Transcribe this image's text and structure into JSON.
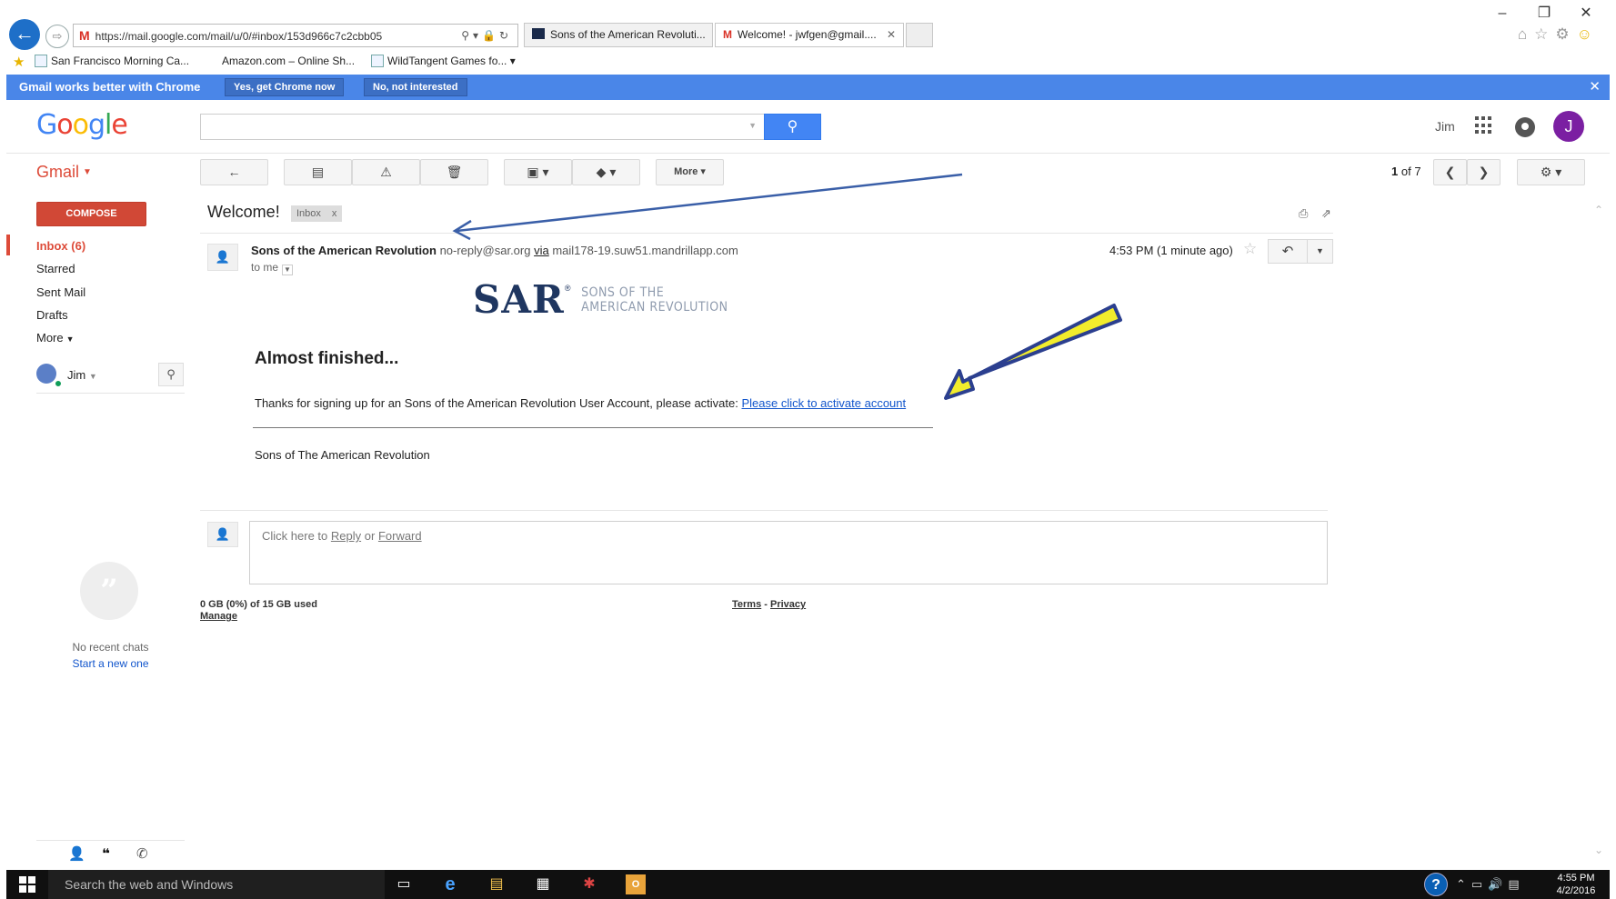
{
  "browser": {
    "url": "https://mail.google.com/mail/u/0/#inbox/153d966c7c2cbb05",
    "tabs": [
      {
        "label": "Sons of the American Revoluti..."
      },
      {
        "label": "Welcome! - jwfgen@gmail...."
      }
    ],
    "favorites": [
      "San Francisco Morning Ca...",
      "Amazon.com – Online Sh...",
      "WildTangent Games fo..."
    ]
  },
  "promo": {
    "message": "Gmail works better with Chrome",
    "yes_label": "Yes, get Chrome now",
    "no_label": "No, not interested"
  },
  "header": {
    "logo_letters": [
      "G",
      "o",
      "o",
      "g",
      "l",
      "e"
    ],
    "user_name": "Jim",
    "avatar_initial": "J"
  },
  "toolbar": {
    "gmail_label": "Gmail",
    "more_label": "More",
    "pager_current": "1",
    "pager_text": "of 7"
  },
  "nav": {
    "compose_label": "COMPOSE",
    "items": [
      {
        "label": "Inbox (6)"
      },
      {
        "label": "Starred"
      },
      {
        "label": "Sent Mail"
      },
      {
        "label": "Drafts"
      },
      {
        "label": "More"
      }
    ],
    "hangouts_user": "Jim",
    "no_chats": "No recent chats",
    "start_new": "Start a new one"
  },
  "message": {
    "subject": "Welcome!",
    "label_chip": "Inbox",
    "sender_name": "Sons of the American Revolution",
    "sender_email": "no-reply@sar.org",
    "via": "via",
    "via_domain": "mail178-19.suw51.mandrillapp.com",
    "to": "to me",
    "time": "4:53 PM (1 minute ago)",
    "logo_main": "SAR",
    "logo_sub_1": "SONS OF THE",
    "logo_sub_2": "AMERICAN REVOLUTION",
    "heading": "Almost finished...",
    "body_text": "Thanks for signing up for an Sons of the American Revolution User Account, please activate:",
    "activate_link": "Please click to activate account",
    "signature": "Sons of The American Revolution"
  },
  "reply": {
    "prefix": "Click here to",
    "reply_link": "Reply",
    "or": "or",
    "forward_link": "Forward"
  },
  "footer": {
    "storage": "0 GB (0%) of 15 GB used",
    "manage": "Manage",
    "terms": "Terms",
    "sep": "-",
    "privacy": "Privacy"
  },
  "taskbar": {
    "search_placeholder": "Search the web and Windows",
    "time": "4:55 PM",
    "date": "4/2/2016"
  },
  "annotations": {
    "arrow_colors": {
      "thin": "#3a5fa8",
      "thick_fill": "#f2ec2c",
      "thick_stroke": "#2b3f8f"
    }
  }
}
